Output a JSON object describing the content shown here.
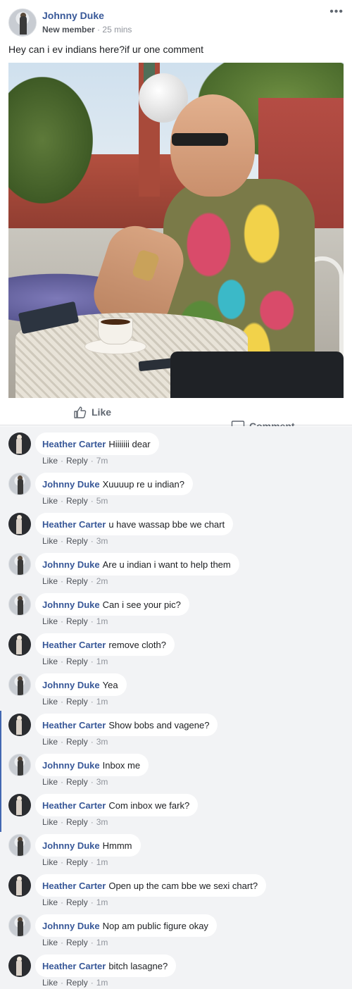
{
  "post": {
    "author": "Johnny Duke",
    "badge": "New member",
    "time": "25 mins",
    "dot": "·",
    "more_icon": "•••",
    "text": "Hey can i ev indians here?if ur one comment"
  },
  "actions": {
    "like_label": "Like",
    "comment_label": "Comment"
  },
  "comment_actions": {
    "like": "Like",
    "reply": "Reply",
    "dot": "·"
  },
  "comments": [
    {
      "author": "Heather Carter",
      "text": "Hiiiiiii dear",
      "time": "7m"
    },
    {
      "author": "Johnny Duke",
      "text": "Xuuuup re u indian?",
      "time": "5m"
    },
    {
      "author": "Heather Carter",
      "text": "u have wassap bbe we chart",
      "time": "3m"
    },
    {
      "author": "Johnny Duke",
      "text": "Are u indian i want to help them",
      "time": "2m"
    },
    {
      "author": "Johnny Duke",
      "text": "Can i see your pic?",
      "time": "1m"
    },
    {
      "author": "Heather Carter",
      "text": "remove cloth?",
      "time": "1m"
    },
    {
      "author": "Johnny Duke",
      "text": "Yea",
      "time": "1m"
    },
    {
      "author": "Heather Carter",
      "text": "Show bobs and vagene?",
      "time": "3m"
    },
    {
      "author": "Johnny Duke",
      "text": "Inbox me",
      "time": "3m"
    },
    {
      "author": "Heather Carter",
      "text": "Com inbox we fark?",
      "time": "3m"
    },
    {
      "author": "Johnny Duke",
      "text": "Hmmm",
      "time": "1m"
    },
    {
      "author": "Heather Carter",
      "text": "Open up the cam bbe we sexi chart?",
      "time": "1m"
    },
    {
      "author": "Johnny Duke",
      "text": "Nop am public figure okay",
      "time": "1m"
    },
    {
      "author": "Heather Carter",
      "text": "bitch lasagne?",
      "time": "1m"
    }
  ],
  "colors": {
    "name_link": "#385898",
    "meta_gray": "#90949c",
    "comments_bg": "#f2f3f5",
    "thread_bar": "#4267b2"
  },
  "icons": {
    "like": "thumbs-up-icon",
    "comment": "speech-bubble-icon",
    "more": "more-options-icon"
  }
}
